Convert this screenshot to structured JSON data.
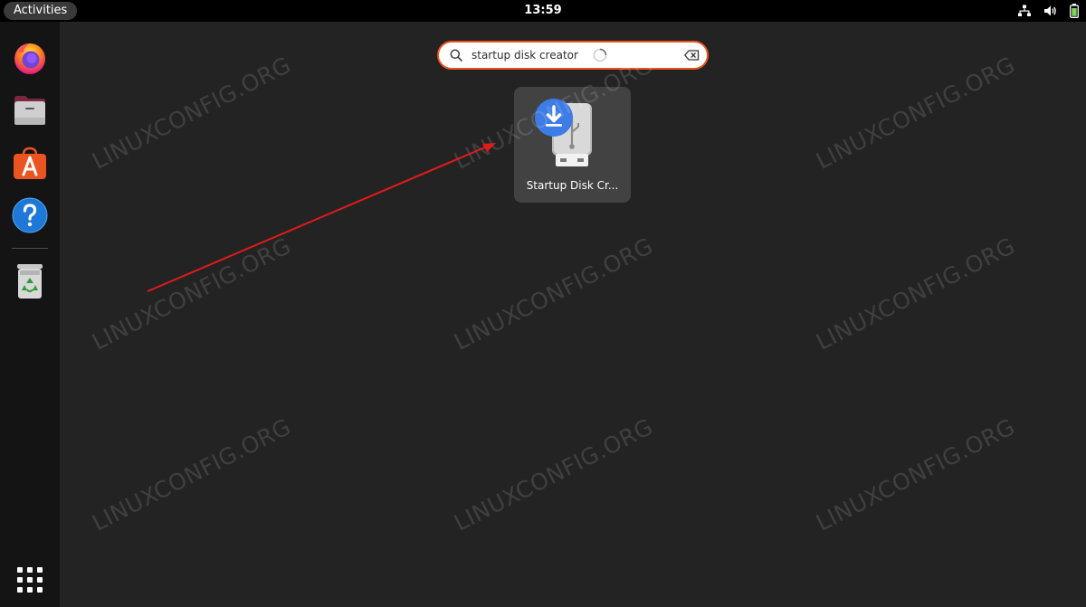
{
  "topbar": {
    "activities_label": "Activities",
    "clock": "13:59",
    "tray_icons": [
      "network-icon",
      "volume-icon",
      "battery-icon"
    ]
  },
  "dock": {
    "apps": [
      {
        "name": "firefox",
        "icon": "firefox-icon"
      },
      {
        "name": "files",
        "icon": "files-icon"
      },
      {
        "name": "ubuntu-software",
        "icon": "software-icon"
      },
      {
        "name": "help",
        "icon": "help-icon"
      },
      {
        "name": "trash",
        "icon": "trash-icon"
      }
    ],
    "app_grid_icon": "app-grid-icon"
  },
  "search": {
    "value": "startup disk creator",
    "icon": "search-icon",
    "clear_icon": "clear-icon"
  },
  "results": [
    {
      "label": "Startup Disk Cr...",
      "icon": "usb-drive-icon"
    }
  ],
  "watermark": "LINUXCONFIG.ORG",
  "colors": {
    "accent": "#e95420",
    "arrow": "#e01b1b",
    "topbar": "#000000",
    "dock": "#141414",
    "workspace": "#232323",
    "tile": "#424242",
    "download_badge": "#3d7be6"
  }
}
